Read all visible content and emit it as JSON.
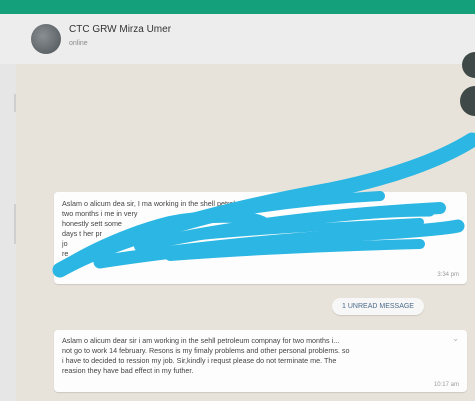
{
  "header": {
    "contact_name": "CTC GRW Mirza Umer",
    "status": "online",
    "accent_color": "#13a07a"
  },
  "messages": [
    {
      "lines": [
        "Aslam o alicum dea          sir, I ma working in the shell petrole        ompny for",
        "two months i          me in          very",
        "honestly                                                              sett some",
        "days t                       her pr",
        "jo",
        "re"
      ],
      "time": "3:34 pm"
    },
    {
      "lines": [
        "Aslam o alicum dear sir i am working in the sehll petroleum compnay for two months i...",
        "not go to work 14 february. Resons is my fimaly problems and other personal problems. so",
        "i have to decided to ression my job. Sir,kindly i requst please do not terminate me. The",
        "reasion they have bad effect in my futher."
      ],
      "time": "10:17 am"
    }
  ],
  "unread_label": "1 UNREAD MESSAGE",
  "scribble_color": "#2bb6e3"
}
